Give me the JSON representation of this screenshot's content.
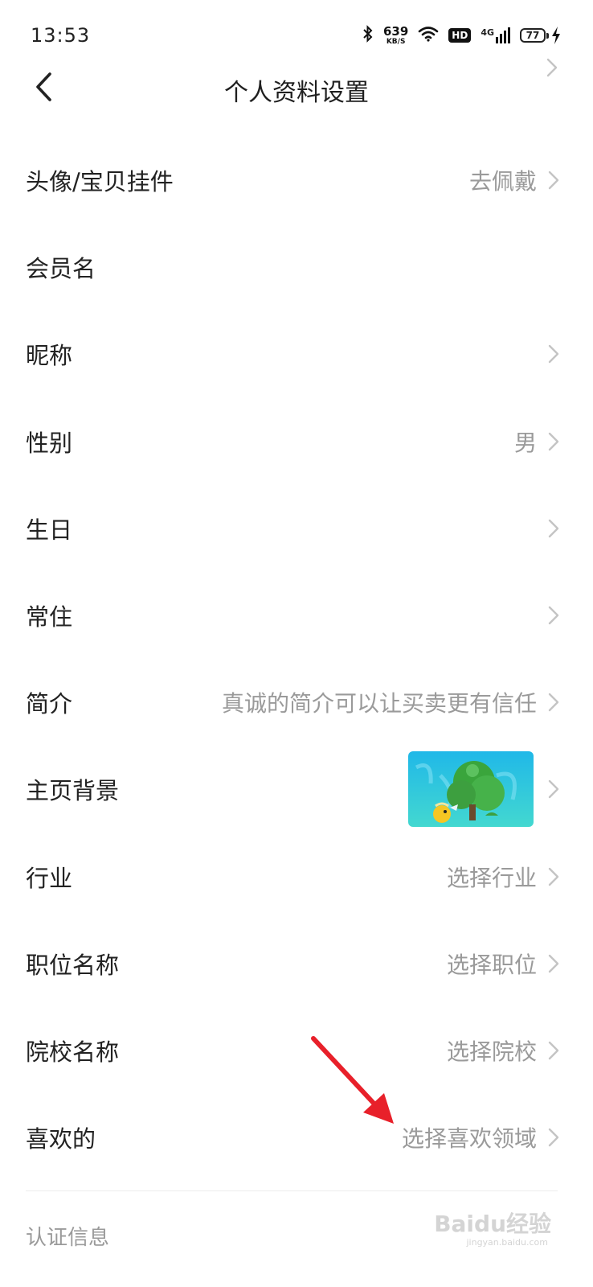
{
  "status_bar": {
    "time": "13:53",
    "net_speed": "639",
    "net_unit": "KB/S",
    "hd": "HD",
    "network": "4G",
    "battery": "77"
  },
  "header": {
    "title": "个人资料设置"
  },
  "rows": [
    {
      "label": "头像/宝贝挂件",
      "value": "去佩戴"
    },
    {
      "label": "会员名",
      "value": ""
    },
    {
      "label": "昵称",
      "value": ""
    },
    {
      "label": "性别",
      "value": "男"
    },
    {
      "label": "生日",
      "value": ""
    },
    {
      "label": "常住",
      "value": ""
    },
    {
      "label": "简介",
      "value": "真诚的简介可以让买卖更有信任"
    },
    {
      "label": "主页背景",
      "value": ""
    },
    {
      "label": "行业",
      "value": "选择行业"
    },
    {
      "label": "职位名称",
      "value": "选择职位"
    },
    {
      "label": "院校名称",
      "value": "选择院校"
    },
    {
      "label": "喜欢的",
      "value": "选择喜欢领域"
    }
  ],
  "section": {
    "label": "认证信息"
  },
  "watermark": {
    "text": "Baidu经验",
    "sub": "jingyan.baidu.com"
  },
  "colors": {
    "annotation_arrow": "#e8202a",
    "value_text": "#9a9a9a",
    "chevron": "#c4c4c4"
  }
}
